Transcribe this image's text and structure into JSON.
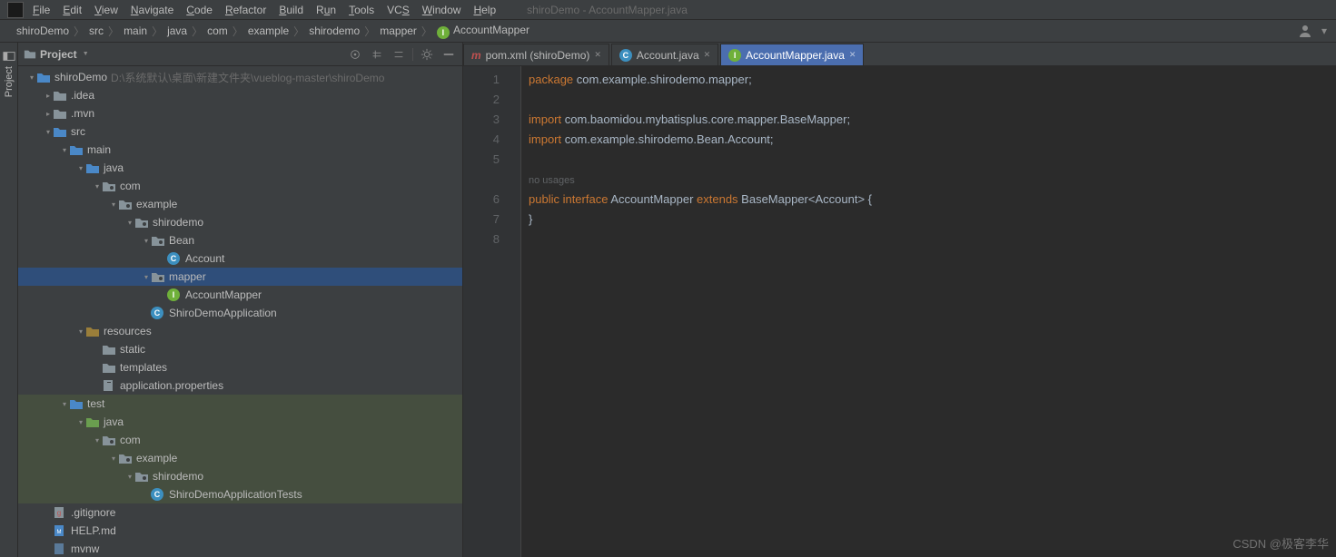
{
  "window": {
    "title": "shiroDemo - AccountMapper.java"
  },
  "menu": [
    "File",
    "Edit",
    "View",
    "Navigate",
    "Code",
    "Refactor",
    "Build",
    "Run",
    "Tools",
    "VCS",
    "Window",
    "Help"
  ],
  "breadcrumbs": [
    "shiroDemo",
    "src",
    "main",
    "java",
    "com",
    "example",
    "shirodemo",
    "mapper",
    "AccountMapper"
  ],
  "panel": {
    "title": "Project"
  },
  "rail": {
    "label": "Project"
  },
  "tree": [
    {
      "d": 0,
      "a": "v",
      "k": "root",
      "t": "shiroDemo",
      "hint": "D:\\系统默认\\桌面\\新建文件夹\\vueblog-master\\shiroDemo"
    },
    {
      "d": 1,
      "a": ">",
      "k": "dir",
      "t": ".idea"
    },
    {
      "d": 1,
      "a": ">",
      "k": "dir",
      "t": ".mvn"
    },
    {
      "d": 1,
      "a": "v",
      "k": "dir-blue",
      "t": "src"
    },
    {
      "d": 2,
      "a": "v",
      "k": "dir-blue",
      "t": "main"
    },
    {
      "d": 3,
      "a": "v",
      "k": "dir-blue",
      "t": "java"
    },
    {
      "d": 4,
      "a": "v",
      "k": "pkg",
      "t": "com"
    },
    {
      "d": 5,
      "a": "v",
      "k": "pkg",
      "t": "example"
    },
    {
      "d": 6,
      "a": "v",
      "k": "pkg",
      "t": "shirodemo"
    },
    {
      "d": 7,
      "a": "v",
      "k": "pkg",
      "t": "Bean"
    },
    {
      "d": 8,
      "a": "",
      "k": "class",
      "t": "Account"
    },
    {
      "d": 7,
      "a": "v",
      "k": "pkg",
      "t": "mapper",
      "sel": true
    },
    {
      "d": 8,
      "a": "",
      "k": "int",
      "t": "AccountMapper"
    },
    {
      "d": 7,
      "a": "",
      "k": "class",
      "t": "ShiroDemoApplication"
    },
    {
      "d": 3,
      "a": "v",
      "k": "res",
      "t": "resources"
    },
    {
      "d": 4,
      "a": "",
      "k": "dir",
      "t": "static"
    },
    {
      "d": 4,
      "a": "",
      "k": "dir",
      "t": "templates"
    },
    {
      "d": 4,
      "a": "",
      "k": "file",
      "t": "application.properties"
    },
    {
      "d": 2,
      "a": "v",
      "k": "dir-blue",
      "t": "test",
      "tint": true
    },
    {
      "d": 3,
      "a": "v",
      "k": "dir-green",
      "t": "java",
      "tint": true
    },
    {
      "d": 4,
      "a": "v",
      "k": "pkg",
      "t": "com",
      "tint": true
    },
    {
      "d": 5,
      "a": "v",
      "k": "pkg",
      "t": "example",
      "tint": true
    },
    {
      "d": 6,
      "a": "v",
      "k": "pkg",
      "t": "shirodemo",
      "tint": true
    },
    {
      "d": 7,
      "a": "",
      "k": "class",
      "t": "ShiroDemoApplicationTests",
      "tint": true
    },
    {
      "d": 1,
      "a": "",
      "k": "git",
      "t": ".gitignore"
    },
    {
      "d": 1,
      "a": "",
      "k": "md",
      "t": "HELP.md"
    },
    {
      "d": 1,
      "a": "",
      "k": "file2",
      "t": "mvnw"
    }
  ],
  "tabs": [
    {
      "label": "pom.xml (shiroDemo)",
      "kind": "maven"
    },
    {
      "label": "Account.java",
      "kind": "class"
    },
    {
      "label": "AccountMapper.java",
      "kind": "int",
      "active": true
    }
  ],
  "code": {
    "lines": [
      "1",
      "2",
      "3",
      "4",
      "5",
      "6",
      "7",
      "8"
    ],
    "l1_kw": "package",
    "l1_rest": " com.example.shirodemo.mapper",
    "l3_kw": "import",
    "l3_rest": " com.baomidou.mybatisplus.core.mapper.BaseMapper",
    "l4_kw": "import",
    "l4_rest": " com.example.shirodemo.Bean.Account",
    "hint": "no usages",
    "l6_a": "public ",
    "l6_b": "interface ",
    "l6_c": "AccountMapper ",
    "l6_d": "extends ",
    "l6_e": "BaseMapper<Account> {",
    "l7": "}"
  },
  "watermark": "CSDN @极客李华"
}
